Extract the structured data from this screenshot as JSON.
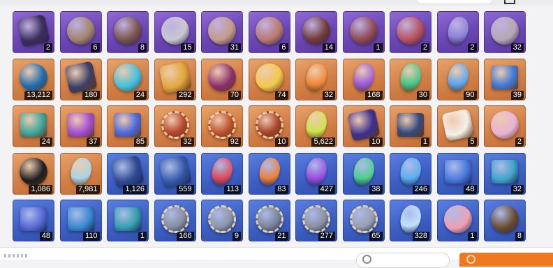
{
  "colors": {
    "rarity_purple": "#6a46b4",
    "rarity_orange": "#d27f45",
    "rarity_blue": "#3d5fc4",
    "count_badge": "#000000",
    "action_button": "#f0781e"
  },
  "inventory": {
    "items": [
      {
        "icon": "card-chip-icon",
        "rarity": "purple",
        "count": "2",
        "color": "#3a2f5c"
      },
      {
        "icon": "coral-head-icon",
        "rarity": "purple",
        "count": "6",
        "color": "#a3846c"
      },
      {
        "icon": "brain-organ-icon",
        "rarity": "purple",
        "count": "8",
        "color": "#7a5548"
      },
      {
        "icon": "silver-orb-icon",
        "rarity": "purple",
        "count": "15",
        "color": "#c9c9cf"
      },
      {
        "icon": "ghoul-face-icon",
        "rarity": "purple",
        "count": "31",
        "color": "#c49b85"
      },
      {
        "icon": "flesh-blob-icon",
        "rarity": "purple",
        "count": "6",
        "color": "#b97a6c"
      },
      {
        "icon": "red-core-rock-icon",
        "rarity": "purple",
        "count": "14",
        "color": "#6f3c34"
      },
      {
        "icon": "screaming-mouth-icon",
        "rarity": "purple",
        "count": "1",
        "color": "#8f4a52"
      },
      {
        "icon": "eyeball-icon",
        "rarity": "purple",
        "count": "2",
        "color": "#b8525b"
      },
      {
        "icon": "crystal-head-icon",
        "rarity": "purple",
        "count": "2",
        "color": "#8a84d8"
      },
      {
        "icon": "shell-mask-icon",
        "rarity": "purple",
        "count": "32",
        "color": "#b7a8b4"
      },
      {
        "icon": "blue-spirit-icon",
        "rarity": "orange",
        "count": "13,212",
        "color": "#1c6cb0"
      },
      {
        "icon": "device-module-icon",
        "rarity": "orange",
        "count": "180",
        "color": "#3a3f66"
      },
      {
        "icon": "energy-orb-icon",
        "rarity": "orange",
        "count": "24",
        "color": "#3fc1e0"
      },
      {
        "icon": "gold-ticket-icon",
        "rarity": "orange",
        "count": "292",
        "color": "#e3a73a"
      },
      {
        "icon": "purple-eye-flesh-icon",
        "rarity": "orange",
        "count": "70",
        "color": "#8b2f6b"
      },
      {
        "icon": "golden-moon-icon",
        "rarity": "orange",
        "count": "74",
        "color": "#f2c94c"
      },
      {
        "icon": "orange-crystal-icon",
        "rarity": "orange",
        "count": "32",
        "color": "#f08a3a"
      },
      {
        "icon": "purple-crystal-icon",
        "rarity": "orange",
        "count": "168",
        "color": "#9b5ce0"
      },
      {
        "icon": "green-crystal-icon",
        "rarity": "orange",
        "count": "30",
        "color": "#45c98a"
      },
      {
        "icon": "blue-crystal-icon",
        "rarity": "orange",
        "count": "90",
        "color": "#5aa8f0"
      },
      {
        "icon": "skill-book-icon",
        "rarity": "orange",
        "count": "39",
        "color": "#3f7ad8"
      },
      {
        "icon": "skill-book-icon",
        "rarity": "orange",
        "count": "24",
        "color": "#3aa8a0"
      },
      {
        "icon": "skill-book-icon",
        "rarity": "orange",
        "count": "37",
        "color": "#a44fd8"
      },
      {
        "icon": "skill-book-icon",
        "rarity": "orange",
        "count": "85",
        "color": "#4b6ae0"
      },
      {
        "icon": "medal-icon",
        "rarity": "orange",
        "count": "32",
        "color": "#b7472e"
      },
      {
        "icon": "medal-icon",
        "rarity": "orange",
        "count": "92",
        "color": "#c0522f"
      },
      {
        "icon": "medal-icon",
        "rarity": "orange",
        "count": "10",
        "color": "#a8432b"
      },
      {
        "icon": "sprout-crystal-icon",
        "rarity": "orange",
        "count": "5,622",
        "color": "#cde54a"
      },
      {
        "icon": "dark-cube-icon",
        "rarity": "orange",
        "count": "10",
        "color": "#3b2f8f"
      },
      {
        "icon": "star-tome-icon",
        "rarity": "orange",
        "count": "1",
        "color": "#34497e"
      },
      {
        "icon": "envelope-icon",
        "rarity": "orange",
        "count": "5",
        "color": "#f4f1ea"
      },
      {
        "icon": "rainbow-stone-icon",
        "rarity": "orange",
        "count": "2",
        "color": "#e8b3d6"
      },
      {
        "icon": "black-urchin-icon",
        "rarity": "orange",
        "count": "1,086",
        "color": "#1c1c1e"
      },
      {
        "icon": "prism-crystal-icon",
        "rarity": "orange",
        "count": "7,981",
        "color": "#a9d6e8"
      },
      {
        "icon": "blue-ticket-icon",
        "rarity": "blue",
        "count": "1,126",
        "color": "#2f4a92"
      },
      {
        "icon": "blue-ticket-icon",
        "rarity": "blue",
        "count": "559",
        "color": "#3557a8"
      },
      {
        "icon": "red-shard-icon",
        "rarity": "blue",
        "count": "113",
        "color": "#e04a5a"
      },
      {
        "icon": "orange-shard-icon",
        "rarity": "blue",
        "count": "83",
        "color": "#f0803a"
      },
      {
        "icon": "violet-shard-icon",
        "rarity": "blue",
        "count": "427",
        "color": "#9b4fe0"
      },
      {
        "icon": "green-shard-icon",
        "rarity": "blue",
        "count": "38",
        "color": "#4fd08a"
      },
      {
        "icon": "blue-shard-icon",
        "rarity": "blue",
        "count": "246",
        "color": "#5cb0f0"
      },
      {
        "icon": "skill-book-icon",
        "rarity": "blue",
        "count": "48",
        "color": "#4a7ae0"
      },
      {
        "icon": "skill-book-icon",
        "rarity": "blue",
        "count": "32",
        "color": "#3fa4c8"
      },
      {
        "icon": "skill-book-icon",
        "rarity": "blue",
        "count": "48",
        "color": "#5a6ad8"
      },
      {
        "icon": "skill-book-icon",
        "rarity": "blue",
        "count": "110",
        "color": "#3a8ad0"
      },
      {
        "icon": "skill-book-icon",
        "rarity": "blue",
        "count": "1",
        "color": "#37a0b0"
      },
      {
        "icon": "silver-medal-icon",
        "rarity": "blue",
        "count": "166",
        "color": "#8a8e9e"
      },
      {
        "icon": "silver-medal-icon",
        "rarity": "blue",
        "count": "9",
        "color": "#9096a8"
      },
      {
        "icon": "silver-medal-icon",
        "rarity": "blue",
        "count": "21",
        "color": "#7e8498"
      },
      {
        "icon": "silver-medal-icon",
        "rarity": "blue",
        "count": "277",
        "color": "#8c90a2"
      },
      {
        "icon": "silver-medal-icon",
        "rarity": "blue",
        "count": "65",
        "color": "#9aa0b0"
      },
      {
        "icon": "ice-crystal-icon",
        "rarity": "blue",
        "count": "328",
        "color": "#bfe4ff"
      },
      {
        "icon": "cake-slice-icon",
        "rarity": "blue",
        "count": "1",
        "color": "#f2a0b0"
      },
      {
        "icon": "pocket-watch-icon",
        "rarity": "blue",
        "count": "8",
        "color": "#6b4a2e"
      }
    ]
  }
}
